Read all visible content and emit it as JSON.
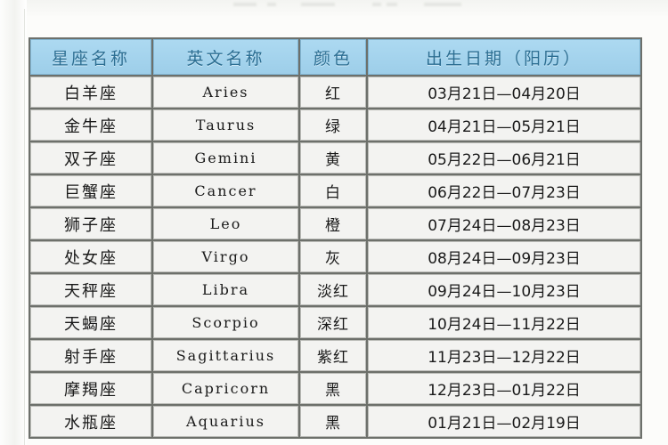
{
  "page": {
    "background_color": "#fcfcfa",
    "top_artifact_text": ""
  },
  "table": {
    "header_bg": "#9fd0e8",
    "header_text_color": "#2d6f93",
    "cell_bg": "#efefed",
    "grid_color": "#6e716c",
    "columns": [
      {
        "key": "name",
        "label": "星座名称"
      },
      {
        "key": "en",
        "label": "英文名称"
      },
      {
        "key": "color",
        "label": "颜色"
      },
      {
        "key": "date",
        "label": "出生日期（阳历）"
      }
    ],
    "rows": [
      {
        "name": "白羊座",
        "en": "Aries",
        "color": "红",
        "date": "03月21日—04月20日"
      },
      {
        "name": "金牛座",
        "en": "Taurus",
        "color": "绿",
        "date": "04月21日—05月21日"
      },
      {
        "name": "双子座",
        "en": "Gemini",
        "color": "黄",
        "date": "05月22日—06月21日"
      },
      {
        "name": "巨蟹座",
        "en": "Cancer",
        "color": "白",
        "date": "06月22日—07月23日"
      },
      {
        "name": "狮子座",
        "en": "Leo",
        "color": "橙",
        "date": "07月24日—08月23日"
      },
      {
        "name": "处女座",
        "en": "Virgo",
        "color": "灰",
        "date": "08月24日—09月23日"
      },
      {
        "name": "天秤座",
        "en": "Libra",
        "color": "淡红",
        "date": "09月24日—10月23日"
      },
      {
        "name": "天蝎座",
        "en": "Scorpio",
        "color": "深红",
        "date": "10月24日—11月22日"
      },
      {
        "name": "射手座",
        "en": "Sagittarius",
        "color": "紫红",
        "date": "11月23日—12月22日"
      },
      {
        "name": "摩羯座",
        "en": "Capricorn",
        "color": "黑",
        "date": "12月23日—01月22日"
      },
      {
        "name": "水瓶座",
        "en": "Aquarius",
        "color": "黑",
        "date": "01月21日—02月19日"
      }
    ]
  }
}
